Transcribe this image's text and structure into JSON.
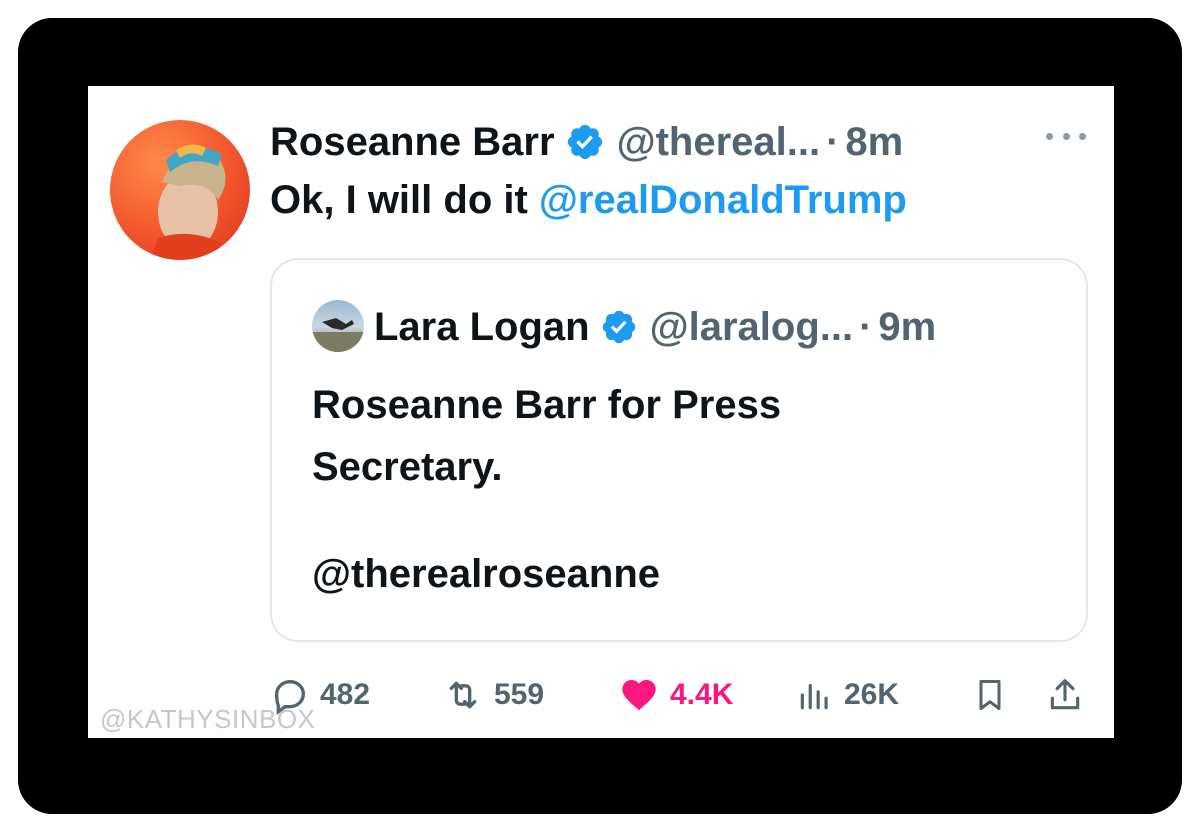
{
  "tweet": {
    "author_name": "Roseanne Barr",
    "handle": "@thereal...",
    "separator": "·",
    "time": "8m",
    "text_prefix": "Ok, I will do it ",
    "mention": "@realDonaldTrump"
  },
  "quoted_tweet": {
    "author_name": "Lara Logan",
    "handle": "@laralog...",
    "separator": "·",
    "time": "9m",
    "text": "Roseanne Barr for Press Secretary.",
    "tag": "@therealroseanne"
  },
  "actions": {
    "replies": "482",
    "reposts": "559",
    "likes": "4.4K",
    "views": "26K"
  },
  "watermark": "@KATHYSINBOX",
  "colors": {
    "accent": "#1d9bf0",
    "like": "#f91880",
    "muted": "#536471",
    "text": "#0f1419"
  },
  "icons": [
    "more-icon",
    "verified-badge-icon",
    "reply-icon",
    "repost-icon",
    "like-icon",
    "views-icon",
    "bookmark-icon",
    "share-icon"
  ]
}
